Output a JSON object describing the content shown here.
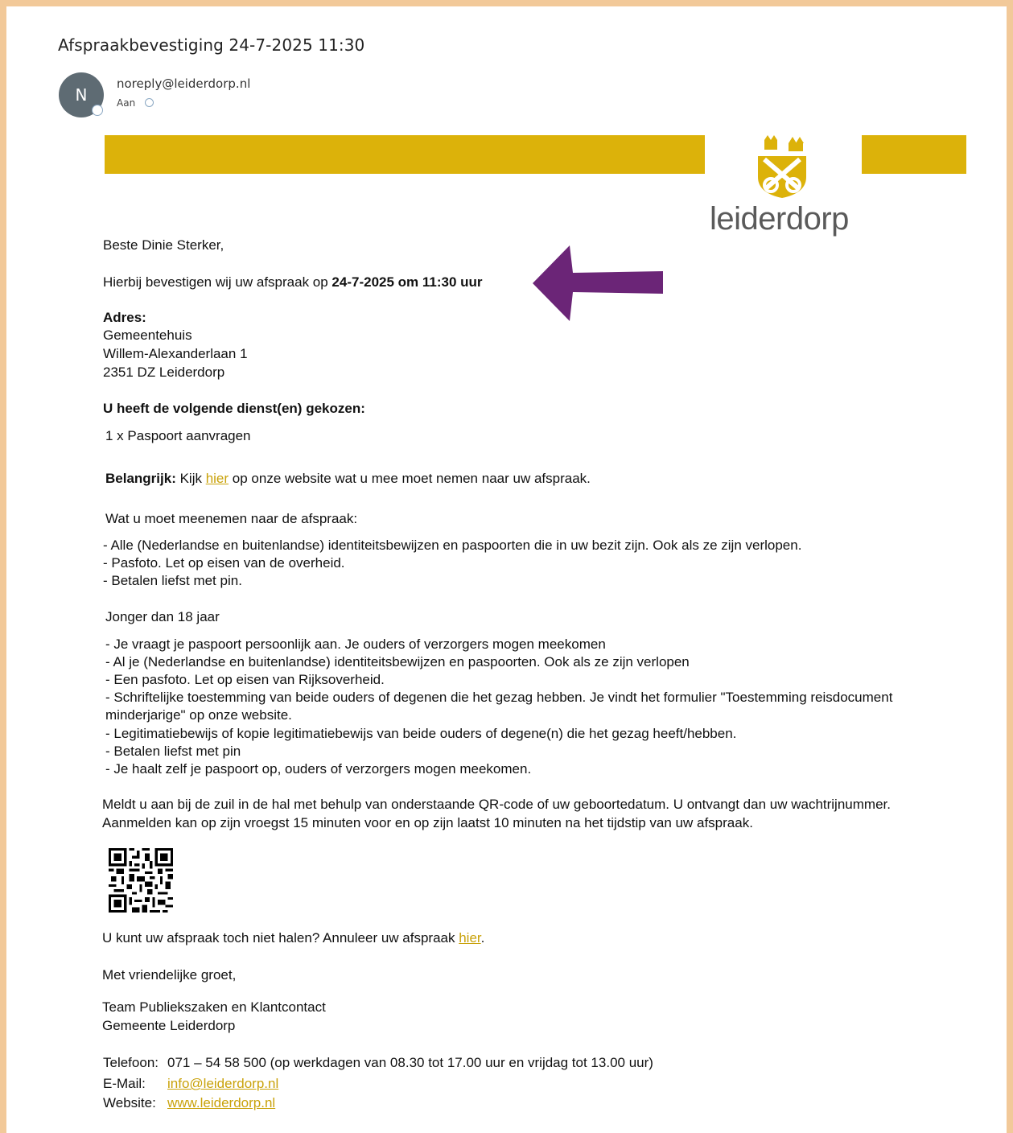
{
  "email": {
    "subject": "Afspraakbevestiging 24-7-2025 11:30",
    "avatar_initial": "N",
    "sender": "noreply@leiderdorp.nl",
    "to_label": "Aan"
  },
  "brand": {
    "logo_text": "leiderdorp",
    "band_color": "#dcb20a",
    "link_color": "#c9a20a",
    "arrow_color": "#6b2577"
  },
  "body": {
    "greeting": "Beste Dinie Sterker,",
    "confirm_prefix": "Hierbij bevestigen wij uw afspraak op ",
    "confirm_datetime": "24-7-2025 om 11:30 uur",
    "address_label": "Adres:",
    "address_lines": [
      "Gemeentehuis",
      "Willem-Alexanderlaan 1",
      "2351 DZ Leiderdorp"
    ],
    "services_heading": "U heeft de volgende dienst(en) gekozen:",
    "service_item": "1 x Paspoort aanvragen",
    "important_label": "Belangrijk:",
    "important_prefix": " Kijk ",
    "important_link": "hier",
    "important_suffix": " op onze website wat u mee moet nemen naar uw afspraak.",
    "bring_heading": "Wat u moet meenemen naar de afspraak:",
    "bring_items": [
      "- Alle (Nederlandse en buitenlandse) identiteitsbewijzen en paspoorten die in uw bezit zijn. Ook als ze zijn verlopen.",
      "- Pasfoto. Let op eisen van de overheid.",
      "- Betalen liefst met pin."
    ],
    "minor_heading": "Jonger dan 18 jaar",
    "minor_items": [
      "- Je vraagt je paspoort persoonlijk aan. Je ouders of verzorgers mogen meekomen",
      "- Al je (Nederlandse en buitenlandse) identiteitsbewijzen en paspoorten. Ook als ze zijn verlopen",
      "- Een pasfoto. Let op eisen van Rijksoverheid.",
      "- Schriftelijke toestemming van beide ouders of degenen die het gezag hebben. Je vindt het formulier \"Toestemming reisdocument",
      "minderjarige\" op onze website.",
      "- Legitimatiebewijs of kopie legitimatiebewijs van beide ouders of degene(n) die het gezag heeft/hebben.",
      "- Betalen liefst met pin",
      "- Je haalt zelf je paspoort op, ouders of verzorgers mogen meekomen."
    ],
    "checkin_lines": [
      "Meldt u aan bij de zuil in de hal met behulp van onderstaande QR-code of uw geboortedatum. U ontvangt dan uw wachtrijnummer.",
      "Aanmelden kan op zijn vroegst 15 minuten voor en op zijn laatst 10 minuten na het tijdstip van uw afspraak."
    ],
    "cancel_prefix": "U kunt uw afspraak toch niet halen? Annuleer uw afspraak ",
    "cancel_link": "hier",
    "cancel_suffix": ".",
    "closing": "Met vriendelijke groet,",
    "team_lines": [
      "Team Publiekszaken en Klantcontact",
      "Gemeente Leiderdorp"
    ],
    "phone_label": "Telefoon:",
    "phone_value": "071 – 54 58 500 (op werkdagen van 08.30 tot 17.00 uur en vrijdag tot 13.00 uur)",
    "email_label": "E-Mail:",
    "email_value": "info@leiderdorp.nl",
    "website_label": "Website:",
    "website_value": "www.leiderdorp.nl"
  }
}
